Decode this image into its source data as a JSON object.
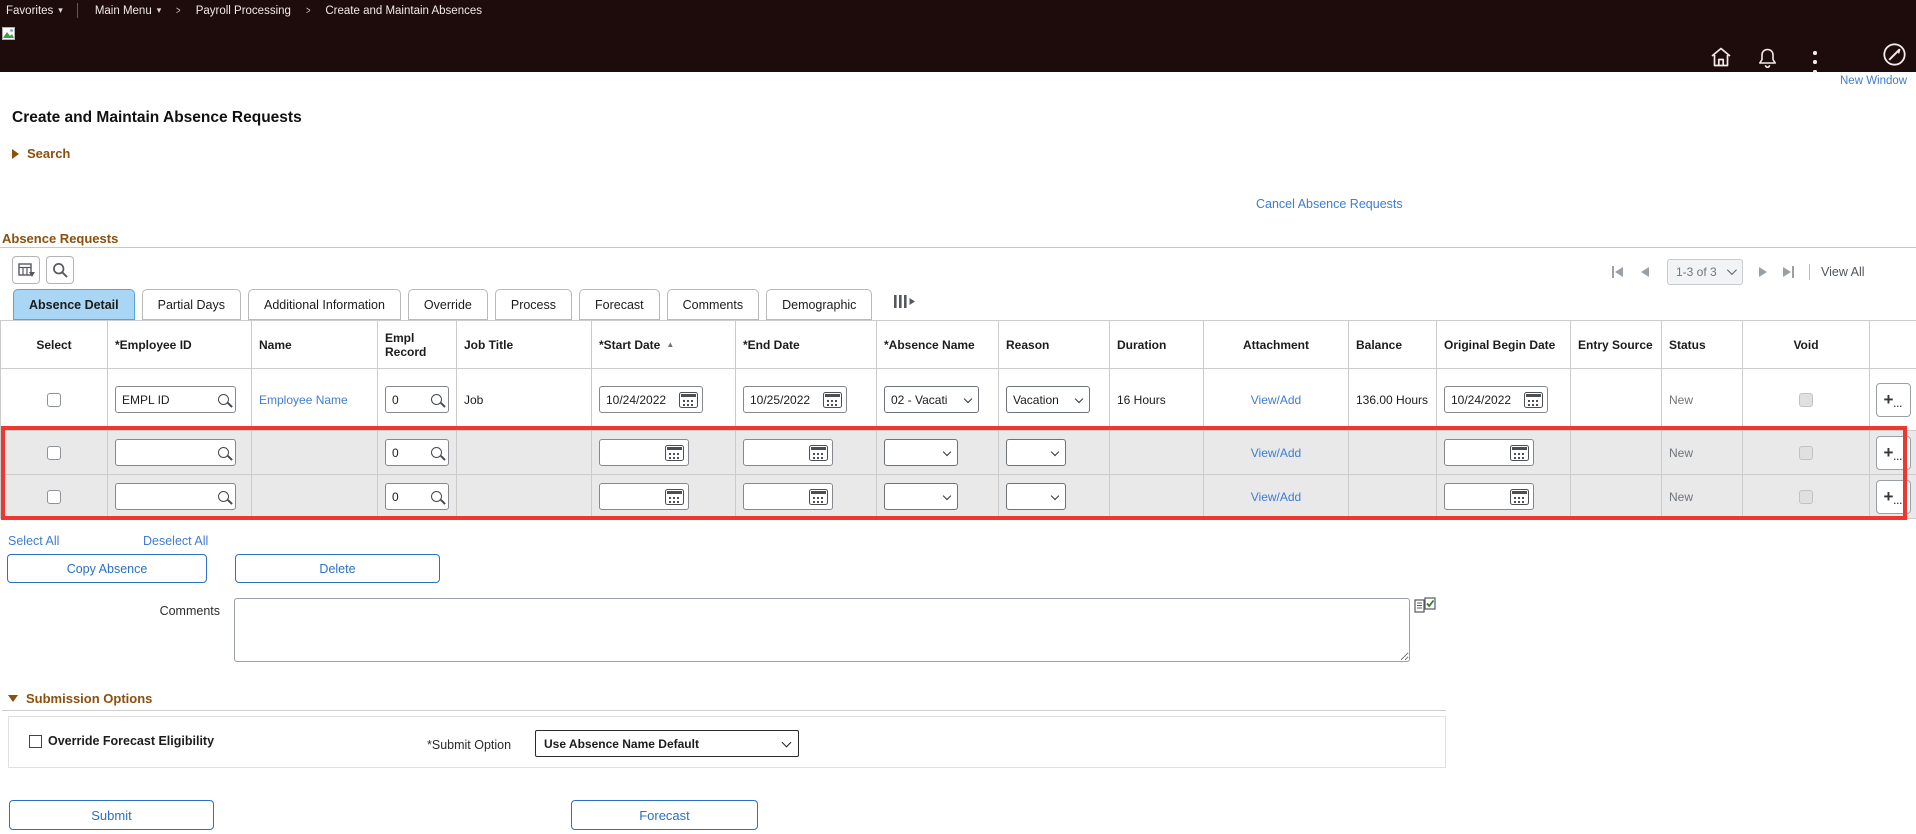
{
  "topbar": {
    "favorites": "Favorites",
    "main_menu": "Main Menu",
    "crumb1": "Payroll Processing",
    "crumb2": "Create and Maintain Absences"
  },
  "header": {
    "new_window": "New Window",
    "title": "Create and Maintain Absence Requests",
    "search_label": "Search",
    "cancel_link": "Cancel Absence Requests"
  },
  "grid": {
    "title": "Absence Requests",
    "pagination": {
      "range": "1-3 of 3",
      "view_all": "View All"
    },
    "tabs": [
      {
        "label": "Absence Detail"
      },
      {
        "label": "Partial Days"
      },
      {
        "label": "Additional Information"
      },
      {
        "label": "Override"
      },
      {
        "label": "Process"
      },
      {
        "label": "Forecast"
      },
      {
        "label": "Comments"
      },
      {
        "label": "Demographic"
      }
    ],
    "columns": [
      "Select",
      "*Employee ID",
      "Name",
      "Empl Record",
      "Job Title",
      "*Start Date",
      "*End Date",
      "*Absence Name",
      "Reason",
      "Duration",
      "Attachment",
      "Balance",
      "Original Begin Date",
      "Entry Source",
      "Status",
      "Void"
    ],
    "rows": [
      {
        "employee_id": "EMPL ID",
        "name": "Employee Name",
        "empl_record": "0",
        "job_title": "Job",
        "start_date": "10/24/2022",
        "end_date": "10/25/2022",
        "absence_name": "02 - Vacati",
        "reason": "Vacation",
        "duration": "16 Hours",
        "attachment": "View/Add",
        "balance": "136.00 Hours",
        "original_begin_date": "10/24/2022",
        "entry_source": "",
        "status": "New"
      },
      {
        "employee_id": "",
        "name": "",
        "empl_record": "0",
        "job_title": "",
        "start_date": "",
        "end_date": "",
        "absence_name": "",
        "reason": "",
        "duration": "",
        "attachment": "View/Add",
        "balance": "",
        "original_begin_date": "",
        "entry_source": "",
        "status": "New"
      },
      {
        "employee_id": "",
        "name": "",
        "empl_record": "0",
        "job_title": "",
        "start_date": "",
        "end_date": "",
        "absence_name": "",
        "reason": "",
        "duration": "",
        "attachment": "View/Add",
        "balance": "",
        "original_begin_date": "",
        "entry_source": "",
        "status": "New"
      }
    ],
    "select_all": "Select All",
    "deselect_all": "Deselect All",
    "copy_button": "Copy Absence",
    "delete_button": "Delete"
  },
  "comments": {
    "label": "Comments",
    "value": ""
  },
  "submission": {
    "title": "Submission Options",
    "override_label": "Override Forecast Eligibility",
    "submit_option_label": "*Submit Option",
    "submit_option_value": "Use Absence Name Default"
  },
  "footer_actions": {
    "submit": "Submit",
    "forecast": "Forecast"
  },
  "colors": {
    "topbar": "#1d0c0b",
    "section_header": "#8c4f0e",
    "link": "#3e7cd6",
    "button_blue": "#2a70c4",
    "active_tab_bg": "#a9d6f5",
    "highlight_border": "#ee372e",
    "new_row_bg": "#e9e9e9"
  }
}
